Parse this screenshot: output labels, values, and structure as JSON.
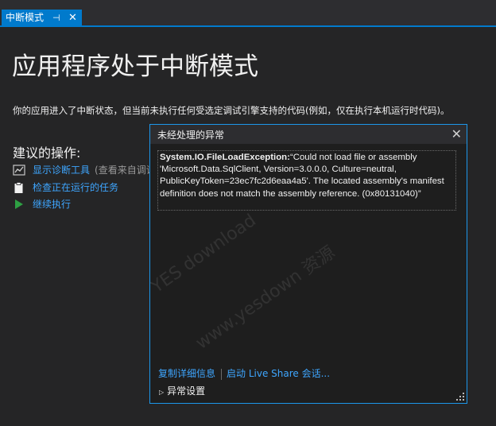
{
  "tab": {
    "label": "中断模式",
    "pin_glyph": "⊣",
    "close_glyph": "✕"
  },
  "page": {
    "title": "应用程序处于中断模式",
    "description": "你的应用进入了中断状态，但当前未执行任何受选定调试引擎支持的代码(例如，仅在执行本机运行时代码)。"
  },
  "actions": {
    "heading": "建议的操作:",
    "items": [
      {
        "label": "显示诊断工具",
        "note": "(查看来自调试",
        "icon": "diagnostics-chart-icon"
      },
      {
        "label": "检查正在运行的任务",
        "icon": "task-clipboard-icon"
      },
      {
        "label": "继续执行",
        "icon": "play-icon"
      }
    ]
  },
  "popup": {
    "title": "未经处理的异常",
    "exception_type": "System.IO.FileLoadException:",
    "exception_message": "“Could not load file or assembly 'Microsoft.Data.SqlClient, Version=3.0.0.0, Culture=neutral, PublicKeyToken=23ec7fc2d6eaa4a5'. The located assembly's manifest definition does not match the assembly reference. (0x80131040)”",
    "copy_details": "复制详细信息",
    "live_share": "启动 Live Share 会话...",
    "exception_settings": "异常设置"
  },
  "watermark": {
    "line1": "YES  download",
    "line2": "www.yesdown  资源"
  },
  "colors": {
    "accent": "#007acc",
    "link": "#3ea6ff",
    "background": "#252526",
    "popup_border": "#1c97ea"
  }
}
